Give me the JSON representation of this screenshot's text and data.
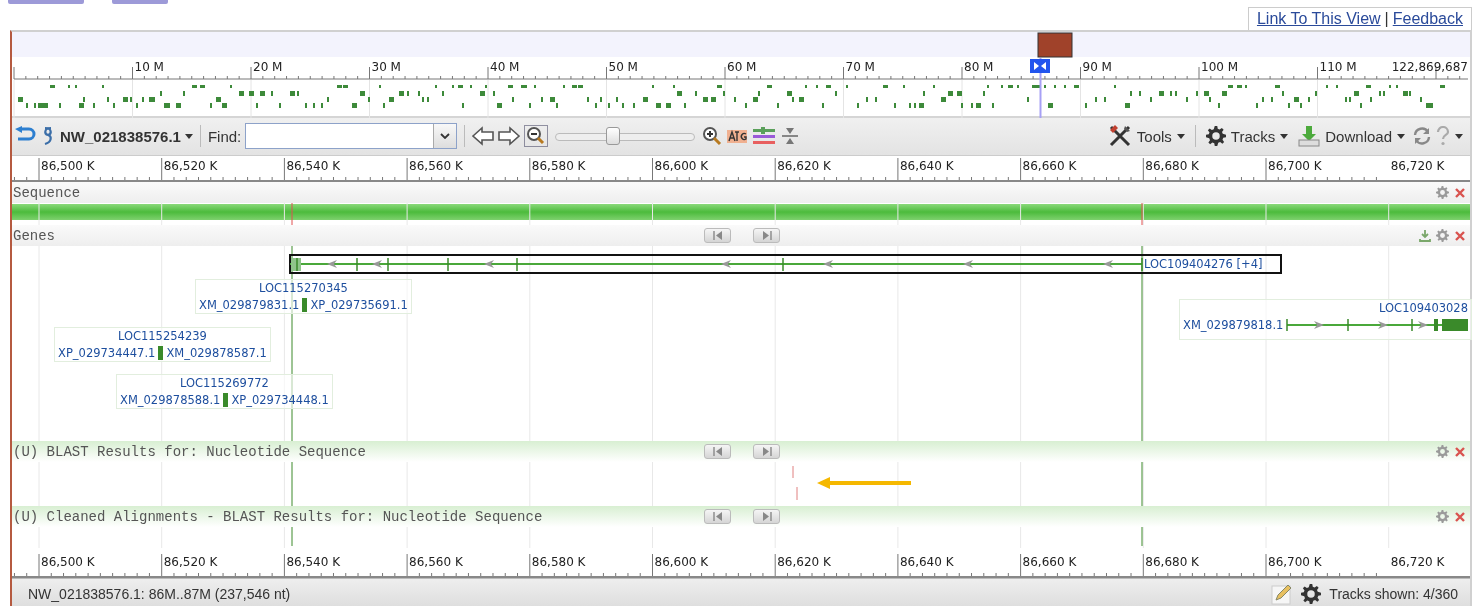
{
  "links": [
    "Link To This View",
    "|",
    "Feedback"
  ],
  "overview": {
    "ticks": [
      "10 M",
      "20 M",
      "30 M",
      "40 M",
      "50 M",
      "60 M",
      "70 M",
      "80 M",
      "90 M",
      "100 M",
      "110 M"
    ],
    "end_label": "122,869,687"
  },
  "toolbar": {
    "sequence": "NW_021838576.1",
    "find_label": "Find:",
    "zoom": {
      "level": 0.41
    },
    "menus": [
      "Tools",
      "Tracks",
      "Download"
    ]
  },
  "ruler_bottom": [
    "86,500 K",
    "86,520 K",
    "86,540 K",
    "86,560 K",
    "86,580 K",
    "86,600 K",
    "86,620 K",
    "86,640 K",
    "86,660 K",
    "86,680 K",
    "86,700 K",
    "86,720 K"
  ],
  "ruler": [
    "86,500 K",
    "86,520 K",
    "86,540 K",
    "86,560 K",
    "86,580 K",
    "86,600 K",
    "86,620 K",
    "86,640 K",
    "86,660 K",
    "86,680 K",
    "86,700 K",
    "86,720 K"
  ],
  "tracks": [
    {
      "kind": "sequence",
      "title": "Sequence"
    },
    {
      "kind": "genes",
      "title": "Genes",
      "genes": [
        {
          "kind": "model",
          "name": "LOC109404276 [+4]",
          "selected": true
        },
        {
          "kind": "compact",
          "name": "LOC115270345",
          "transcripts": [
            "XM_029879831.1",
            "XP_029735691.1"
          ],
          "selected": false
        },
        {
          "kind": "compact",
          "name": "LOC115254239",
          "transcripts": [
            "XP_029734447.1",
            "XM_029878587.1"
          ],
          "selected": false
        },
        {
          "kind": "compact",
          "name": "LOC115269772",
          "transcripts": [
            "XM_029878588.1",
            "XP_029734448.1"
          ],
          "selected": false
        },
        {
          "kind": "model",
          "name": "LOC109403028",
          "transcripts": [
            "XM_029879818.1"
          ],
          "selected": false
        }
      ]
    },
    {
      "kind": "blast_hits",
      "title": "(U) BLAST Results for: Nucleotide Sequence"
    },
    {
      "kind": "blast_empty",
      "title": "(U) Cleaned Alignments - BLAST Results for: Nucleotide Sequence"
    }
  ],
  "status": {
    "range": "NW_021838576.1: 86M..87M (237,546 nt)",
    "tracks_shown": "Tracks shown: 4/360"
  }
}
